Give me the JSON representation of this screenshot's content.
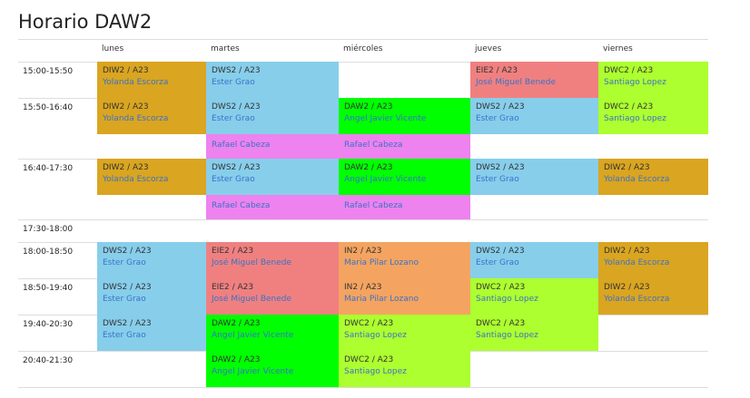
{
  "title": "Horario DAW2",
  "colors": {
    "DIW2": "#daa520",
    "DWS2": "#87ceeb",
    "EIE2": "#f08080",
    "DWC2": "#adff2f",
    "DAW2": "#00ff00",
    "IN2": "#f4a460",
    "DESDOBLE": "#ee82ee",
    "teacher_text": "#3a72c9",
    "grid_line": "#dddddd"
  },
  "days": [
    "lunes",
    "martes",
    "miércoles",
    "jueves",
    "viernes"
  ],
  "slots": [
    {
      "time": "15:00-15:50",
      "rows": [
        [
          {
            "subject": "DIW2 / A23",
            "teacher": "Yolanda Escorza",
            "color": "DIW2"
          },
          {
            "subject": "DWS2 / A23",
            "teacher": "Ester Grao",
            "color": "DWS2"
          },
          null,
          {
            "subject": "EIE2 / A23",
            "teacher": "José Miguel Benede",
            "color": "EIE2"
          },
          {
            "subject": "DWC2 / A23",
            "teacher": "Santiago Lopez",
            "color": "DWC2"
          }
        ]
      ]
    },
    {
      "time": "15:50-16:40",
      "rows": [
        [
          {
            "subject": "DIW2 / A23",
            "teacher": "Yolanda Escorza",
            "color": "DIW2"
          },
          {
            "subject": "DWS2 / A23",
            "teacher": "Ester Grao",
            "color": "DWS2"
          },
          {
            "subject": "DAW2 / A23",
            "teacher": "Angel Javier Vicente",
            "color": "DAW2"
          },
          {
            "subject": "DWS2 / A23",
            "teacher": "Ester Grao",
            "color": "DWS2"
          },
          {
            "subject": "DWC2 / A23",
            "teacher": "Santiago Lopez",
            "color": "DWC2"
          }
        ],
        [
          null,
          {
            "subject": "",
            "teacher": "Rafael Cabeza",
            "color": "DESDOBLE"
          },
          {
            "subject": "",
            "teacher": "Rafael Cabeza",
            "color": "DESDOBLE"
          },
          null,
          null
        ]
      ]
    },
    {
      "time": "16:40-17:30",
      "rows": [
        [
          {
            "subject": "DIW2 / A23",
            "teacher": "Yolanda Escorza",
            "color": "DIW2"
          },
          {
            "subject": "DWS2 / A23",
            "teacher": "Ester Grao",
            "color": "DWS2"
          },
          {
            "subject": "DAW2 / A23",
            "teacher": "Angel Javier Vicente",
            "color": "DAW2"
          },
          {
            "subject": "DWS2 / A23",
            "teacher": "Ester Grao",
            "color": "DWS2"
          },
          {
            "subject": "DIW2 / A23",
            "teacher": "Yolanda Escorza",
            "color": "DIW2"
          }
        ],
        [
          null,
          {
            "subject": "",
            "teacher": "Rafael Cabeza",
            "color": "DESDOBLE"
          },
          {
            "subject": "",
            "teacher": "Rafael Cabeza",
            "color": "DESDOBLE"
          },
          null,
          null
        ]
      ]
    },
    {
      "time": "17:30-18:00",
      "rows": []
    },
    {
      "time": "18:00-18:50",
      "rows": [
        [
          {
            "subject": "DWS2 / A23",
            "teacher": "Ester Grao",
            "color": "DWS2"
          },
          {
            "subject": "EIE2 / A23",
            "teacher": "José Miguel Benede",
            "color": "EIE2"
          },
          {
            "subject": "IN2 / A23",
            "teacher": "Maria Pilar Lozano",
            "color": "IN2"
          },
          {
            "subject": "DWS2 / A23",
            "teacher": "Ester Grao",
            "color": "DWS2"
          },
          {
            "subject": "DIW2 / A23",
            "teacher": "Yolanda Escorza",
            "color": "DIW2"
          }
        ]
      ]
    },
    {
      "time": "18:50-19:40",
      "rows": [
        [
          {
            "subject": "DWS2 / A23",
            "teacher": "Ester Grao",
            "color": "DWS2"
          },
          {
            "subject": "EIE2 / A23",
            "teacher": "José Miguel Benede",
            "color": "EIE2"
          },
          {
            "subject": "IN2 / A23",
            "teacher": "Maria Pilar Lozano",
            "color": "IN2"
          },
          {
            "subject": "DWC2 / A23",
            "teacher": "Santiago Lopez",
            "color": "DWC2"
          },
          {
            "subject": "DIW2 / A23",
            "teacher": "Yolanda Escorza",
            "color": "DIW2"
          }
        ]
      ]
    },
    {
      "time": "19:40-20:30",
      "rows": [
        [
          {
            "subject": "DWS2 / A23",
            "teacher": "Ester Grao",
            "color": "DWS2"
          },
          {
            "subject": "DAW2 / A23",
            "teacher": "Angel Javier Vicente",
            "color": "DAW2"
          },
          {
            "subject": "DWC2 / A23",
            "teacher": "Santiago Lopez",
            "color": "DWC2"
          },
          {
            "subject": "DWC2 / A23",
            "teacher": "Santiago Lopez",
            "color": "DWC2"
          },
          null
        ]
      ]
    },
    {
      "time": "20:40-21:30",
      "rows": [
        [
          null,
          {
            "subject": "DAW2 / A23",
            "teacher": "Angel Javier Vicente",
            "color": "DAW2"
          },
          {
            "subject": "DWC2 / A23",
            "teacher": "Santiago Lopez",
            "color": "DWC2"
          },
          null,
          null
        ]
      ]
    }
  ]
}
